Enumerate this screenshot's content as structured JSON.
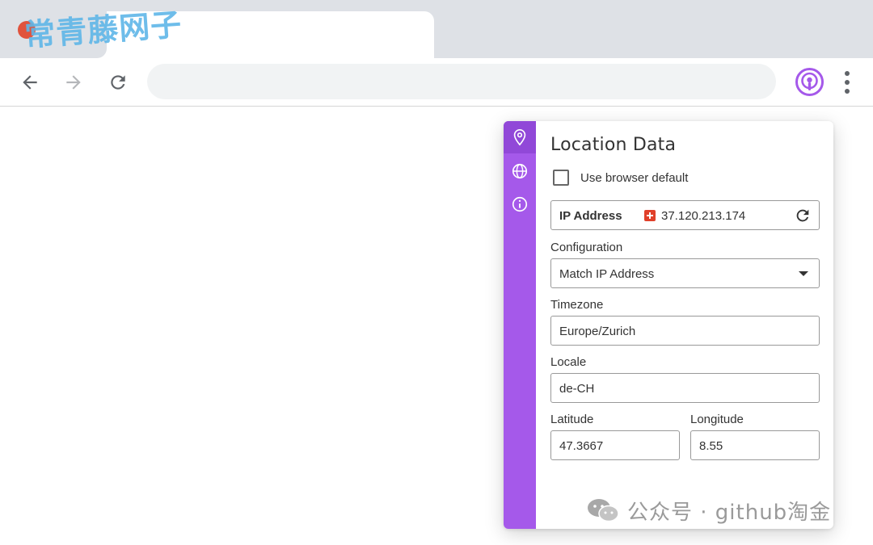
{
  "watermark": {
    "top_text": "常青藤网子",
    "bottom_text": "公众号 · github淘金"
  },
  "toolbar": {
    "back_icon": "arrow-left-icon",
    "forward_icon": "arrow-right-icon",
    "reload_icon": "reload-icon",
    "extension_icon": "podcast-broadcast-icon",
    "menu_icon": "vertical-dots-icon",
    "extension_color": "#a559ea"
  },
  "popup": {
    "accent": "#a559ea",
    "rail": [
      {
        "icon": "location-pin-icon",
        "active": true
      },
      {
        "icon": "globe-icon",
        "active": false
      },
      {
        "icon": "info-icon",
        "active": false
      }
    ],
    "title": "Location Data",
    "use_browser_default": {
      "label": "Use browser default",
      "checked": false
    },
    "ip": {
      "label": "IP Address",
      "flag": "switzerland-flag-icon",
      "value": "37.120.213.174",
      "refresh_icon": "refresh-icon"
    },
    "configuration": {
      "label": "Configuration",
      "value": "Match IP Address"
    },
    "timezone": {
      "label": "Timezone",
      "value": "Europe/Zurich"
    },
    "locale": {
      "label": "Locale",
      "value": "de-CH"
    },
    "latitude": {
      "label": "Latitude",
      "value": "47.3667"
    },
    "longitude": {
      "label": "Longitude",
      "value": "8.55"
    }
  }
}
